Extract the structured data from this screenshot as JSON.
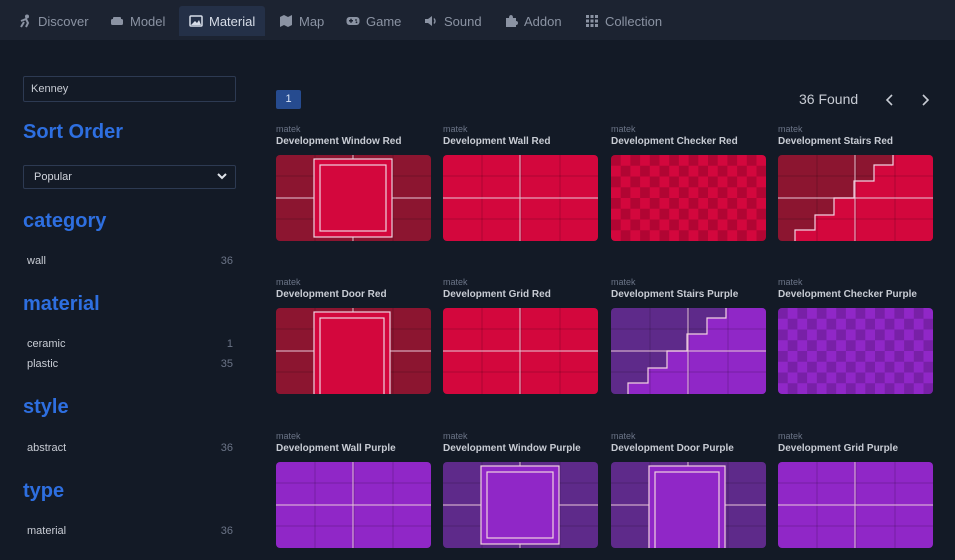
{
  "nav": {
    "tabs": [
      {
        "label": "Discover",
        "icon": "person-icon"
      },
      {
        "label": "Model",
        "icon": "sofa-icon"
      },
      {
        "label": "Material",
        "icon": "image-icon"
      },
      {
        "label": "Map",
        "icon": "map-icon"
      },
      {
        "label": "Game",
        "icon": "gamepad-icon"
      },
      {
        "label": "Sound",
        "icon": "speaker-icon"
      },
      {
        "label": "Addon",
        "icon": "puzzle-icon"
      },
      {
        "label": "Collection",
        "icon": "grid-icon"
      }
    ],
    "active": "Material"
  },
  "sidebar": {
    "search_value": "Kenney",
    "sort_heading": "Sort Order",
    "sort_value": "Popular",
    "sections": [
      {
        "title": "category",
        "items": [
          {
            "label": "wall",
            "count": "36"
          }
        ]
      },
      {
        "title": "material",
        "items": [
          {
            "label": "ceramic",
            "count": "1"
          },
          {
            "label": "plastic",
            "count": "35"
          }
        ]
      },
      {
        "title": "style",
        "items": [
          {
            "label": "abstract",
            "count": "36"
          }
        ]
      },
      {
        "title": "type",
        "items": [
          {
            "label": "material",
            "count": "36"
          }
        ]
      }
    ]
  },
  "results": {
    "page": "1",
    "found": "36 Found",
    "items": [
      {
        "author": "matek",
        "name": "Development Window Red",
        "pattern": "window",
        "color": "red"
      },
      {
        "author": "matek",
        "name": "Development Wall Red",
        "pattern": "wall",
        "color": "red"
      },
      {
        "author": "matek",
        "name": "Development Checker Red",
        "pattern": "checker",
        "color": "red"
      },
      {
        "author": "matek",
        "name": "Development Stairs Red",
        "pattern": "stairs",
        "color": "red"
      },
      {
        "author": "matek",
        "name": "Development Door Red",
        "pattern": "door",
        "color": "red"
      },
      {
        "author": "matek",
        "name": "Development Grid Red",
        "pattern": "wall",
        "color": "red"
      },
      {
        "author": "matek",
        "name": "Development Stairs Purple",
        "pattern": "stairs",
        "color": "purple"
      },
      {
        "author": "matek",
        "name": "Development Checker Purple",
        "pattern": "checker",
        "color": "purple"
      },
      {
        "author": "matek",
        "name": "Development Wall Purple",
        "pattern": "wall",
        "color": "purple"
      },
      {
        "author": "matek",
        "name": "Development Window Purple",
        "pattern": "window",
        "color": "purple"
      },
      {
        "author": "matek",
        "name": "Development Door Purple",
        "pattern": "door",
        "color": "purple"
      },
      {
        "author": "matek",
        "name": "Development Grid Purple",
        "pattern": "wall",
        "color": "purple"
      }
    ]
  },
  "colors": {
    "accent": "#2e6fe0",
    "red_main": "#d3073d",
    "red_dark": "#8c1530",
    "purple_main": "#9027c7",
    "purple_dark": "#5e2a8a"
  }
}
